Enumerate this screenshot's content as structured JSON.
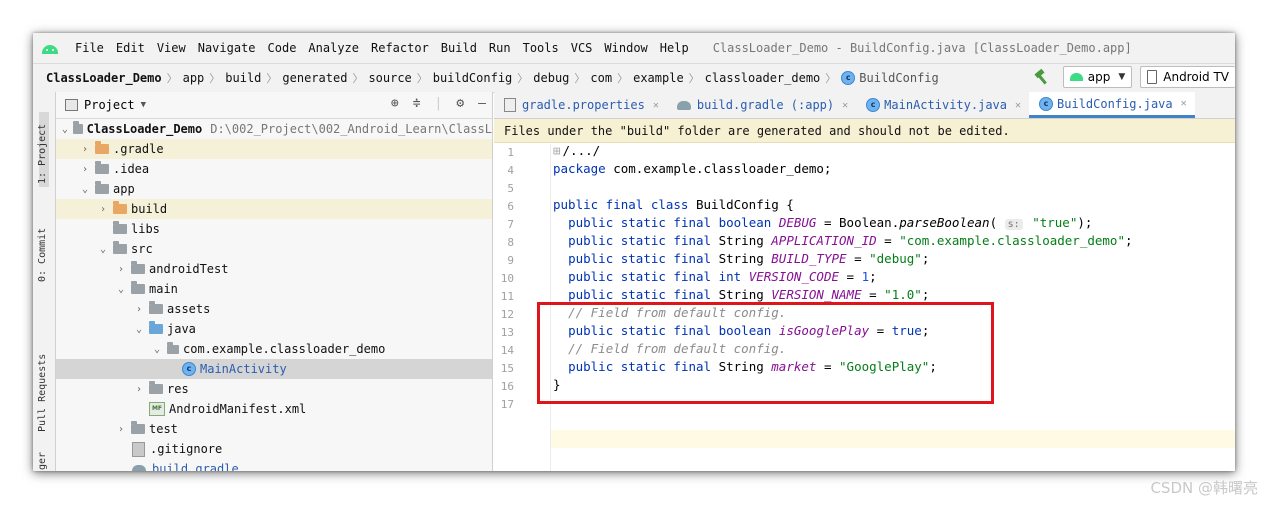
{
  "menubar": {
    "items": [
      "File",
      "Edit",
      "View",
      "Navigate",
      "Code",
      "Analyze",
      "Refactor",
      "Build",
      "Run",
      "Tools",
      "VCS",
      "Window",
      "Help"
    ],
    "window_title": "ClassLoader_Demo - BuildConfig.java [ClassLoader_Demo.app]"
  },
  "navbar": {
    "crumbs": [
      "ClassLoader_Demo",
      "app",
      "build",
      "generated",
      "source",
      "buildConfig",
      "debug",
      "com",
      "example",
      "classloader_demo",
      "BuildConfig"
    ],
    "run_config": "app",
    "device": "Android TV"
  },
  "left_strip": {
    "tabs": [
      "1: Project",
      "0: Commit",
      "Pull Requests",
      "ger"
    ]
  },
  "project_panel": {
    "view_label": "Project",
    "tree": [
      {
        "label": "ClassLoader_Demo",
        "path": "D:\\002_Project\\002_Android_Learn\\ClassL"
      },
      {
        "label": ".gradle"
      },
      {
        "label": ".idea"
      },
      {
        "label": "app"
      },
      {
        "label": "build"
      },
      {
        "label": "libs"
      },
      {
        "label": "src"
      },
      {
        "label": "androidTest"
      },
      {
        "label": "main"
      },
      {
        "label": "assets"
      },
      {
        "label": "java"
      },
      {
        "label": "com.example.classloader_demo"
      },
      {
        "label": "MainActivity"
      },
      {
        "label": "res"
      },
      {
        "label": "AndroidManifest.xml"
      },
      {
        "label": "test"
      },
      {
        "label": ".gitignore"
      },
      {
        "label": "build.gradle"
      }
    ]
  },
  "editor_tabs": [
    {
      "label": "gradle.properties",
      "icon": "properties-icon"
    },
    {
      "label": "build.gradle (:app)",
      "icon": "gradle-icon"
    },
    {
      "label": "MainActivity.java",
      "icon": "class-icon"
    },
    {
      "label": "BuildConfig.java",
      "icon": "class-icon",
      "active": true
    }
  ],
  "banner": "Files under the \"build\" folder are generated and should not be edited.",
  "code": {
    "line_numbers": [
      "1",
      "4",
      "5",
      "6",
      "7",
      "8",
      "9",
      "10",
      "11",
      "12",
      "13",
      "14",
      "15",
      "16",
      "17"
    ],
    "fold": "/.../",
    "package_kw": "package",
    "package_name": "com.example.classloader_demo;",
    "class_decl": {
      "kw": "public final class",
      "name": "BuildConfig {"
    },
    "mods": "public static final",
    "debug": {
      "type": "boolean",
      "name": "DEBUG",
      "eq": " = Boolean.",
      "method": "parseBoolean",
      "open": "(",
      "hint": "s:",
      "value": "\"true\"",
      "end": ");"
    },
    "app_id": {
      "type": "String",
      "name": "APPLICATION_ID",
      "eq": " = ",
      "value": "\"com.example.classloader_demo\"",
      "end": ";"
    },
    "build_type": {
      "type": "String",
      "name": "BUILD_TYPE",
      "eq": " = ",
      "value": "\"debug\"",
      "end": ";"
    },
    "version_code": {
      "type": "int",
      "name": "VERSION_CODE",
      "eq": " = ",
      "value": "1",
      "end": ";"
    },
    "version_name": {
      "type": "String",
      "name": "VERSION_NAME",
      "eq": " = ",
      "value": "\"1.0\"",
      "end": ";"
    },
    "comment1": "// Field from default config.",
    "is_google_play": {
      "type": "boolean",
      "name": "isGooglePlay",
      "eq": " = ",
      "value": "true",
      "end": ";"
    },
    "comment2": "// Field from default config.",
    "market": {
      "type": "String",
      "name": "market",
      "eq": " = ",
      "value": "\"GooglePlay\"",
      "end": ";"
    },
    "close_brace": "}"
  },
  "watermark": "CSDN @韩曙亮",
  "colors": {
    "highlight_box": "#e0151b",
    "keyword": "#0033b3",
    "field": "#871094",
    "string": "#067d17"
  }
}
